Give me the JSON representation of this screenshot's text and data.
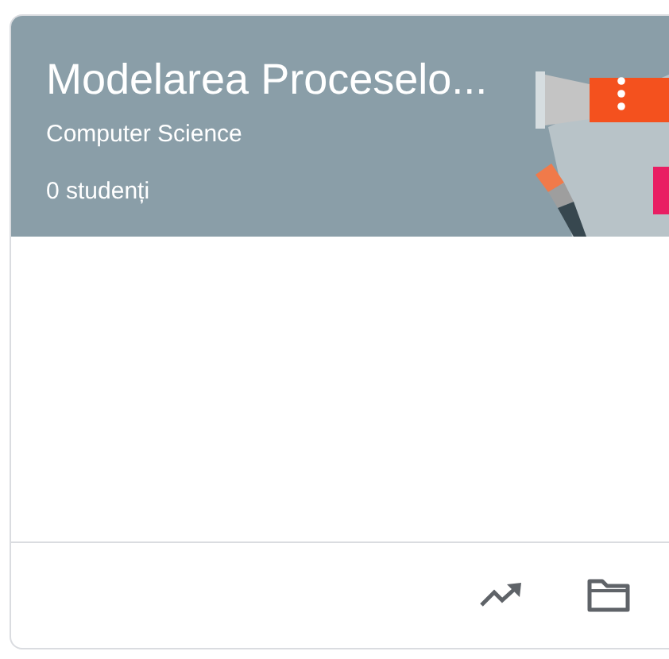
{
  "card": {
    "title": "Modelarea Proceselo...",
    "section": "Computer Science",
    "students": "0 studenți"
  }
}
